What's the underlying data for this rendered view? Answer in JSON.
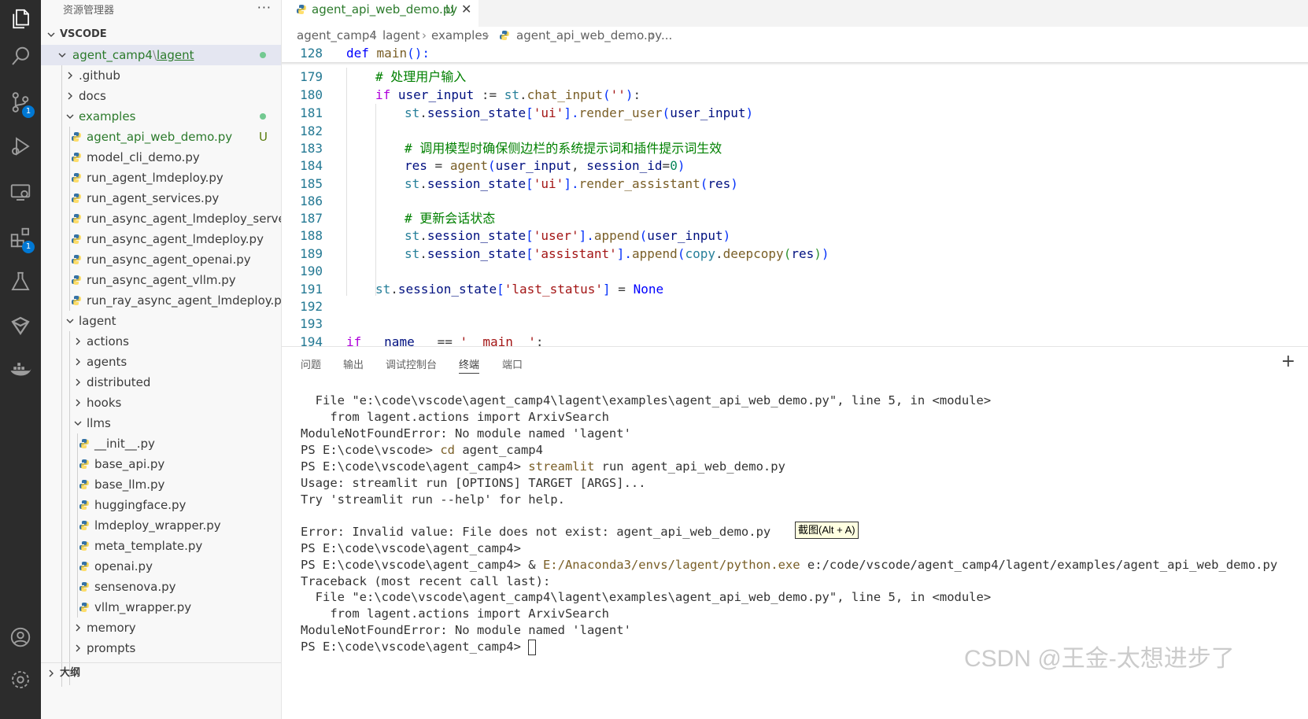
{
  "activity_bar": {
    "icons": [
      "explorer-icon",
      "search-icon",
      "source-control-icon",
      "run-debug-icon",
      "remote-explorer-icon",
      "extensions-icon",
      "testing-icon",
      "pipeline-icon",
      "docker-icon",
      "account-icon",
      "settings-icon"
    ],
    "source_control_badge": "1",
    "extensions_badge": "1"
  },
  "sidebar": {
    "title": "资源管理器",
    "more": "···",
    "section": "VSCODE",
    "root_folder": "agent_camp4",
    "root_sep": "\\",
    "root_sub": "lagent",
    "items": [
      {
        "label": ".github"
      },
      {
        "label": "docs"
      },
      {
        "label": "examples"
      },
      {
        "label": "agent_api_web_demo.py",
        "status": "U"
      },
      {
        "label": "model_cli_demo.py"
      },
      {
        "label": "run_agent_lmdeploy.py"
      },
      {
        "label": "run_agent_services.py"
      },
      {
        "label": "run_async_agent_lmdeploy_server...."
      },
      {
        "label": "run_async_agent_lmdeploy.py"
      },
      {
        "label": "run_async_agent_openai.py"
      },
      {
        "label": "run_async_agent_vllm.py"
      },
      {
        "label": "run_ray_async_agent_lmdeploy.py"
      },
      {
        "label": "lagent"
      },
      {
        "label": "actions"
      },
      {
        "label": "agents"
      },
      {
        "label": "distributed"
      },
      {
        "label": "hooks"
      },
      {
        "label": "llms"
      },
      {
        "label": "__init__.py"
      },
      {
        "label": "base_api.py"
      },
      {
        "label": "base_llm.py"
      },
      {
        "label": "huggingface.py"
      },
      {
        "label": "lmdeploy_wrapper.py"
      },
      {
        "label": "meta_template.py"
      },
      {
        "label": "openai.py"
      },
      {
        "label": "sensenova.py"
      },
      {
        "label": "vllm_wrapper.py"
      },
      {
        "label": "memory"
      },
      {
        "label": "prompts"
      }
    ],
    "outline": "大纲"
  },
  "editor": {
    "tab": {
      "label": "agent_api_web_demo.py",
      "status": "U",
      "close": "✕"
    },
    "breadcrumb": [
      "agent_camp4",
      "lagent",
      "examples",
      "agent_api_web_demo.py",
      "..."
    ],
    "line_numbers": [
      "128",
      "179",
      "180",
      "181",
      "182",
      "183",
      "184",
      "185",
      "186",
      "187",
      "188",
      "189",
      "190",
      "191",
      "192",
      "193",
      "194"
    ],
    "code": {
      "l128_kw": "def",
      "l128_fn": "main",
      "l128_p": "():",
      "l179_cmt": "# 处理用户输入",
      "l180_kw": "if",
      "l180_var": "user_input",
      "l180_op": " := ",
      "l180_st": "st",
      "l180_dot": ".",
      "l180_fn": "chat_input",
      "l180_p1": "(",
      "l180_str": "''",
      "l180_p2": ")",
      "l180_end": ":",
      "l181_st": "st",
      "l181_a": ".",
      "l181_ss": "session_state",
      "l181_b": "[",
      "l181_str": "'ui'",
      "l181_c": "].",
      "l181_fn": "render_user",
      "l181_p1": "(",
      "l181_var": "user_input",
      "l181_p2": ")",
      "l183_cmt": "# 调用模型时确保侧边栏的系统提示词和插件提示词生效",
      "l184_var": "res",
      "l184_eq": " = ",
      "l184_fn": "agent",
      "l184_p1": "(",
      "l184_arg": "user_input",
      "l184_comma": ", ",
      "l184_kwarg": "session_id",
      "l184_eq2": "=",
      "l184_num": "0",
      "l184_p2": ")",
      "l185_st": "st",
      "l185_a": ".",
      "l185_ss": "session_state",
      "l185_b": "[",
      "l185_str": "'ui'",
      "l185_c": "].",
      "l185_fn": "render_assistant",
      "l185_p1": "(",
      "l185_var": "res",
      "l185_p2": ")",
      "l187_cmt": "# 更新会话状态",
      "l188_st": "st",
      "l188_a": ".",
      "l188_ss": "session_state",
      "l188_b": "[",
      "l188_str": "'user'",
      "l188_c": "].",
      "l188_fn": "append",
      "l188_p1": "(",
      "l188_var": "user_input",
      "l188_p2": ")",
      "l189_st": "st",
      "l189_a": ".",
      "l189_ss": "session_state",
      "l189_b": "[",
      "l189_str": "'assistant'",
      "l189_c": "].",
      "l189_fn": "append",
      "l189_p1": "(",
      "l189_cp": "copy",
      "l189_dot": ".",
      "l189_fn2": "deepcopy",
      "l189_p2": "(",
      "l189_var": "res",
      "l189_p3": ")",
      "l189_p4": ")",
      "l191_st": "st",
      "l191_a": ".",
      "l191_ss": "session_state",
      "l191_b": "[",
      "l191_str": "'last_status'",
      "l191_c": "]",
      "l191_eq": " = ",
      "l191_none": "None",
      "l194_kw": "if",
      "l194_var": "__name__",
      "l194_eq": " == ",
      "l194_str": "'__main__'",
      "l194_end": ":"
    }
  },
  "panel": {
    "tabs": [
      "问题",
      "输出",
      "调试控制台",
      "终端",
      "端口"
    ],
    "active_tab": "终端",
    "add": "+",
    "terminal_lines": [
      {
        "text": "  File \"e:\\code\\vscode\\agent_camp4\\lagent\\examples\\agent_api_web_demo.py\", line 5, in <module>"
      },
      {
        "text": "    from lagent.actions import ArxivSearch"
      },
      {
        "text": "ModuleNotFoundError: No module named 'lagent'"
      },
      {
        "prompt": "PS E:\\code\\vscode> ",
        "cmd": "cd",
        "rest": " agent_camp4"
      },
      {
        "prompt": "PS E:\\code\\vscode\\agent_camp4> ",
        "cmd": "streamlit",
        "rest": " run agent_api_web_demo.py"
      },
      {
        "text": "Usage: streamlit run [OPTIONS] TARGET [ARGS]..."
      },
      {
        "text": "Try 'streamlit run --help' for help."
      },
      {
        "text": ""
      },
      {
        "text": "Error: Invalid value: File does not exist: agent_api_web_demo.py"
      },
      {
        "text": "PS E:\\code\\vscode\\agent_camp4>"
      },
      {
        "prompt": "PS E:\\code\\vscode\\agent_camp4> & ",
        "cmd": "E:/Anaconda3/envs/lagent/python.exe",
        "rest": " e:/code/vscode/agent_camp4/lagent/examples/agent_api_web_demo.py"
      },
      {
        "text": "Traceback (most recent call last):"
      },
      {
        "text": "  File \"e:\\code\\vscode\\agent_camp4\\lagent\\examples\\agent_api_web_demo.py\", line 5, in <module>"
      },
      {
        "text": "    from lagent.actions import ArxivSearch"
      },
      {
        "text": "ModuleNotFoundError: No module named 'lagent'"
      },
      {
        "text": "PS E:\\code\\vscode\\agent_camp4> "
      }
    ]
  },
  "overlay": {
    "screenshot_tip": "截图(Alt + A)",
    "watermark": "CSDN @王金-太想进步了"
  }
}
